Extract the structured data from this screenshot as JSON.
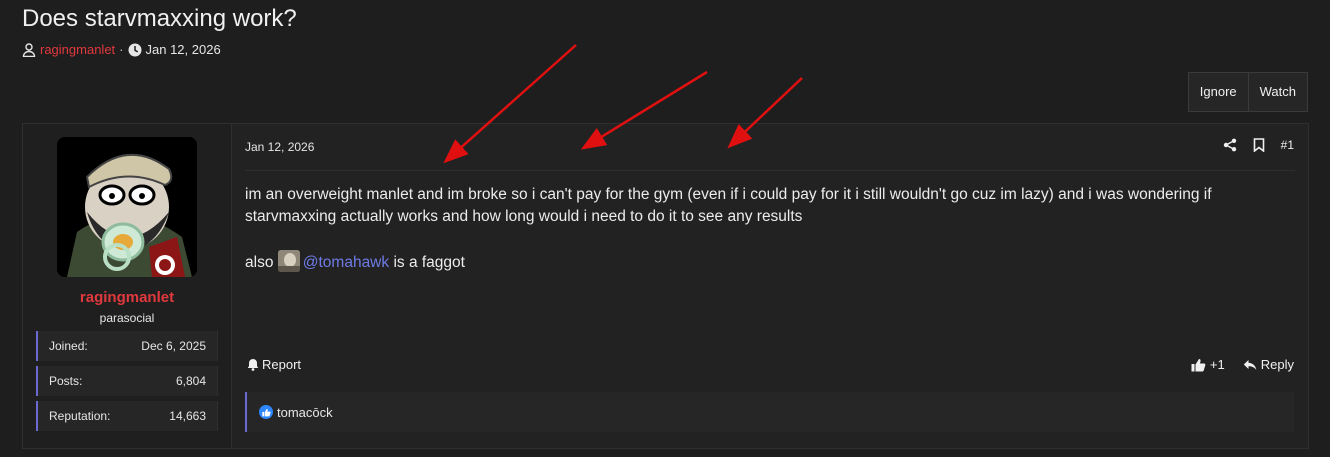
{
  "thread": {
    "title": "Does starvmaxxing work?",
    "author": "ragingmanlet",
    "date": "Jan 12, 2026",
    "separator": "·"
  },
  "actions": {
    "ignore_label": "Ignore",
    "watch_label": "Watch"
  },
  "user": {
    "name": "ragingmanlet",
    "title": "parasocial",
    "stats": [
      {
        "label": "Joined:",
        "value": "Dec 6, 2025"
      },
      {
        "label": "Posts:",
        "value": "6,804"
      },
      {
        "label": "Reputation:",
        "value": "14,663"
      }
    ]
  },
  "post": {
    "date": "Jan 12, 2026",
    "number": "#1",
    "body_line1": "im an overweight manlet and im broke so i can't pay for the gym (even if i could pay for it i still wouldn't go cuz im lazy) and i was wondering if starvmaxxing actually works and how long would i need to do it to see any results",
    "body_line2_prefix": "also",
    "mention": "@tomahawk",
    "body_line2_suffix": "is a faggot"
  },
  "footer": {
    "report_label": "Report",
    "like_count": "+1",
    "reply_label": "Reply",
    "reaction_user": "tomacōck"
  },
  "icons": {
    "author": "user-icon",
    "date": "clock-icon",
    "share": "share-icon",
    "bookmark": "bookmark-icon",
    "report": "bell-icon",
    "like": "thumbs-up-icon",
    "reply": "reply-icon"
  },
  "colors": {
    "background": "#1e1e1e",
    "username": "#e0393e",
    "mention": "#6e7be6",
    "accent_border": "#6a6ad0",
    "annotation_arrow": "#e01010",
    "like_badge": "#2d86ff"
  }
}
